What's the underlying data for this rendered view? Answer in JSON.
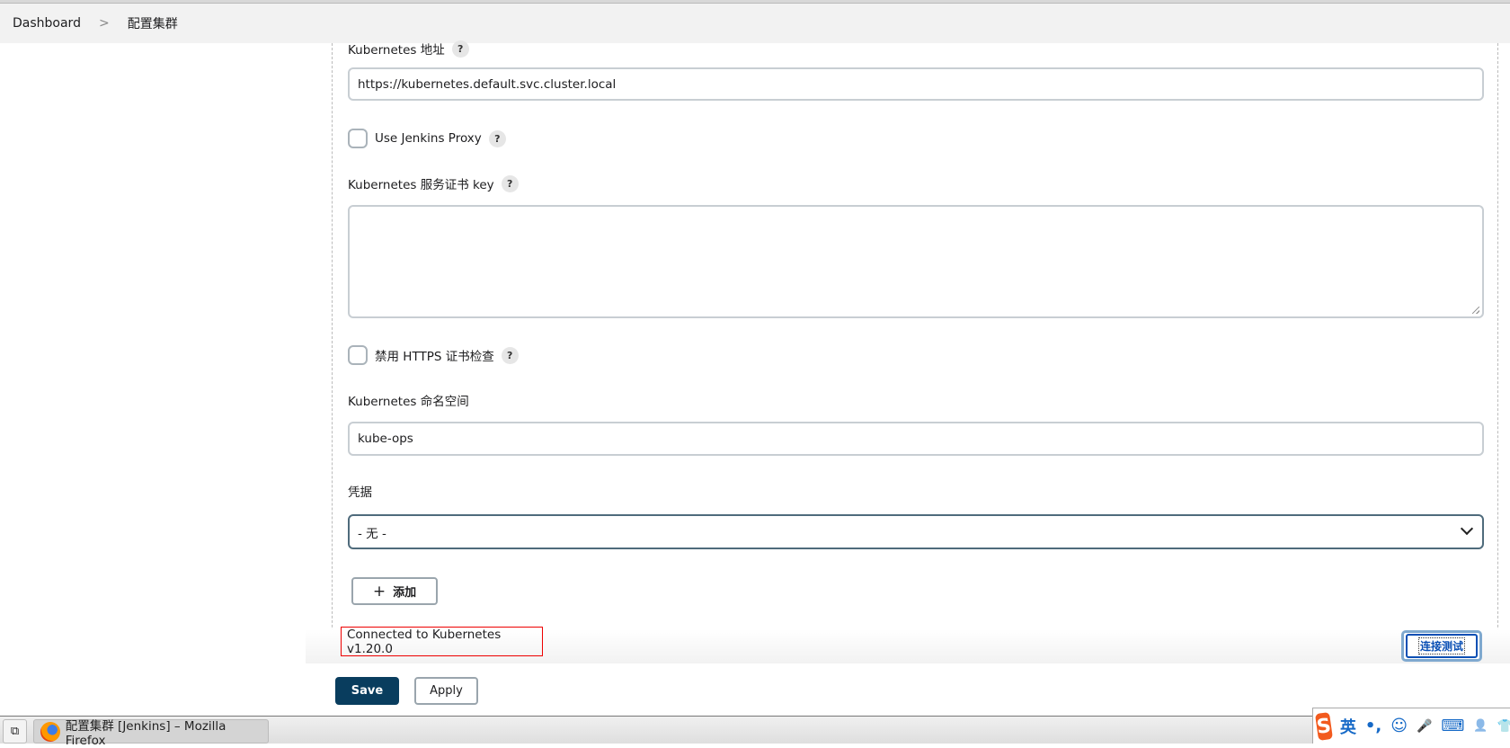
{
  "breadcrumb": {
    "items": [
      "Dashboard",
      "配置集群"
    ],
    "separator": ">"
  },
  "form": {
    "k8s_url": {
      "label": "Kubernetes 地址",
      "value": "https://kubernetes.default.svc.cluster.local"
    },
    "use_proxy": {
      "label": "Use Jenkins Proxy",
      "checked": false
    },
    "cert_key": {
      "label": "Kubernetes 服务证书 key",
      "value": ""
    },
    "disable_https": {
      "label": "禁用 HTTPS 证书检查",
      "checked": false
    },
    "namespace": {
      "label": "Kubernetes 命名空间",
      "value": "kube-ops"
    },
    "credentials": {
      "label": "凭据",
      "selected": "- 无 -"
    },
    "add_button": {
      "icon": "+",
      "label": "添加"
    },
    "connection_status": "Connected to Kubernetes v1.20.0",
    "test_button": "连接测试",
    "help": "?"
  },
  "actions": {
    "save": "Save",
    "apply": "Apply"
  },
  "taskbar": {
    "window_title": "配置集群 [Jenkins] – Mozilla Firefox"
  },
  "ime": {
    "logo": "S",
    "mode": "英",
    "punct": "•,",
    "emoji": "☺",
    "mic": "🎤",
    "keyboard": "⌨",
    "user": "👤",
    "skin": "👕"
  },
  "colors": {
    "primary": "#093d5e",
    "status_border": "#ee0000",
    "link_blue": "#0a4fb4"
  }
}
